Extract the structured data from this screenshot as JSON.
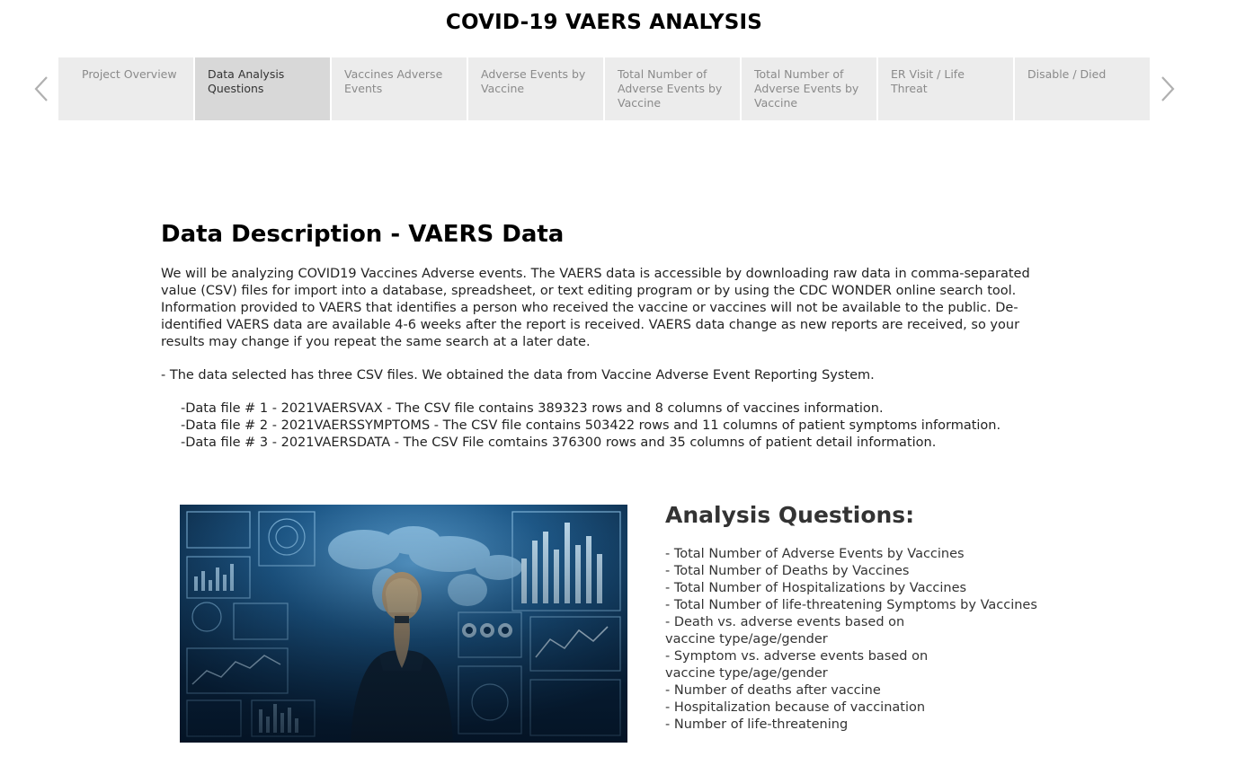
{
  "header": {
    "title": "COVID-19 VAERS ANALYSIS"
  },
  "nav": {
    "tabs": [
      {
        "label": "Project Overview"
      },
      {
        "label": "Data Analysis Questions"
      },
      {
        "label": "Vaccines Adverse Events"
      },
      {
        "label": "Adverse Events by Vaccine"
      },
      {
        "label": "Total Number of Adverse Events by Vaccine"
      },
      {
        "label": "Total Number of Adverse Events by Vaccine"
      },
      {
        "label": "ER Visit / Life Threat"
      },
      {
        "label": "Disable / Died"
      }
    ],
    "active_index": 1,
    "prev_icon": "chevron-left-icon",
    "next_icon": "chevron-right-icon"
  },
  "description": {
    "heading": "Data Description - VAERS Data",
    "paragraph": "We will be analyzing COVID19 Vaccines Adverse events. The VAERS data is accessible by downloading raw data in comma-separated value (CSV) files for import into a database, spreadsheet, or text editing program or by using the CDC WONDER online search tool. Information provided to VAERS that identifies a person who received the vaccine or vaccines will not be available to the public. De-identified VAERS data are available 4-6 weeks after the report is received. VAERS data change as new reports are received, so your results may change if you repeat the same search at a later date.",
    "source_line": "- The data selected has three CSV files. We obtained the data from Vaccine Adverse Event Reporting System.",
    "files": [
      "-Data file # 1 - 2021VAERSVAX - The CSV file contains 389323 rows and 8 columns of vaccines information.",
      "-Data file # 2 - 2021VAERSSYMPTOMS - The CSV file contains 503422 rows and 11 columns of patient symptoms information.",
      "-Data file # 3 - 2021VAERSDATA - The CSV File comtains 376300 rows and 35 columns of patient detail information."
    ]
  },
  "analysis": {
    "heading": "Analysis Questions:",
    "items": [
      "- Total Number of Adverse Events by Vaccines",
      "- Total Number of Deaths by Vaccines",
      "- Total Number of Hospitalizations by Vaccines",
      "- Total Number of life-threatening Symptoms by Vaccines",
      "- Death vs. adverse events based on vaccine type/age/gender",
      "- Symptom vs. adverse events based on vaccine type/age/gender",
      "- Number of deaths after vaccine",
      "- Hospitalization because of vaccination",
      "- Number of life-threatening"
    ]
  },
  "image": {
    "subject": "woman-facing-data-dashboard-image"
  },
  "colors": {
    "tab_bg": "#ececec",
    "tab_active_bg": "#d8d8d8",
    "photo_bg": "#0b2a47"
  }
}
